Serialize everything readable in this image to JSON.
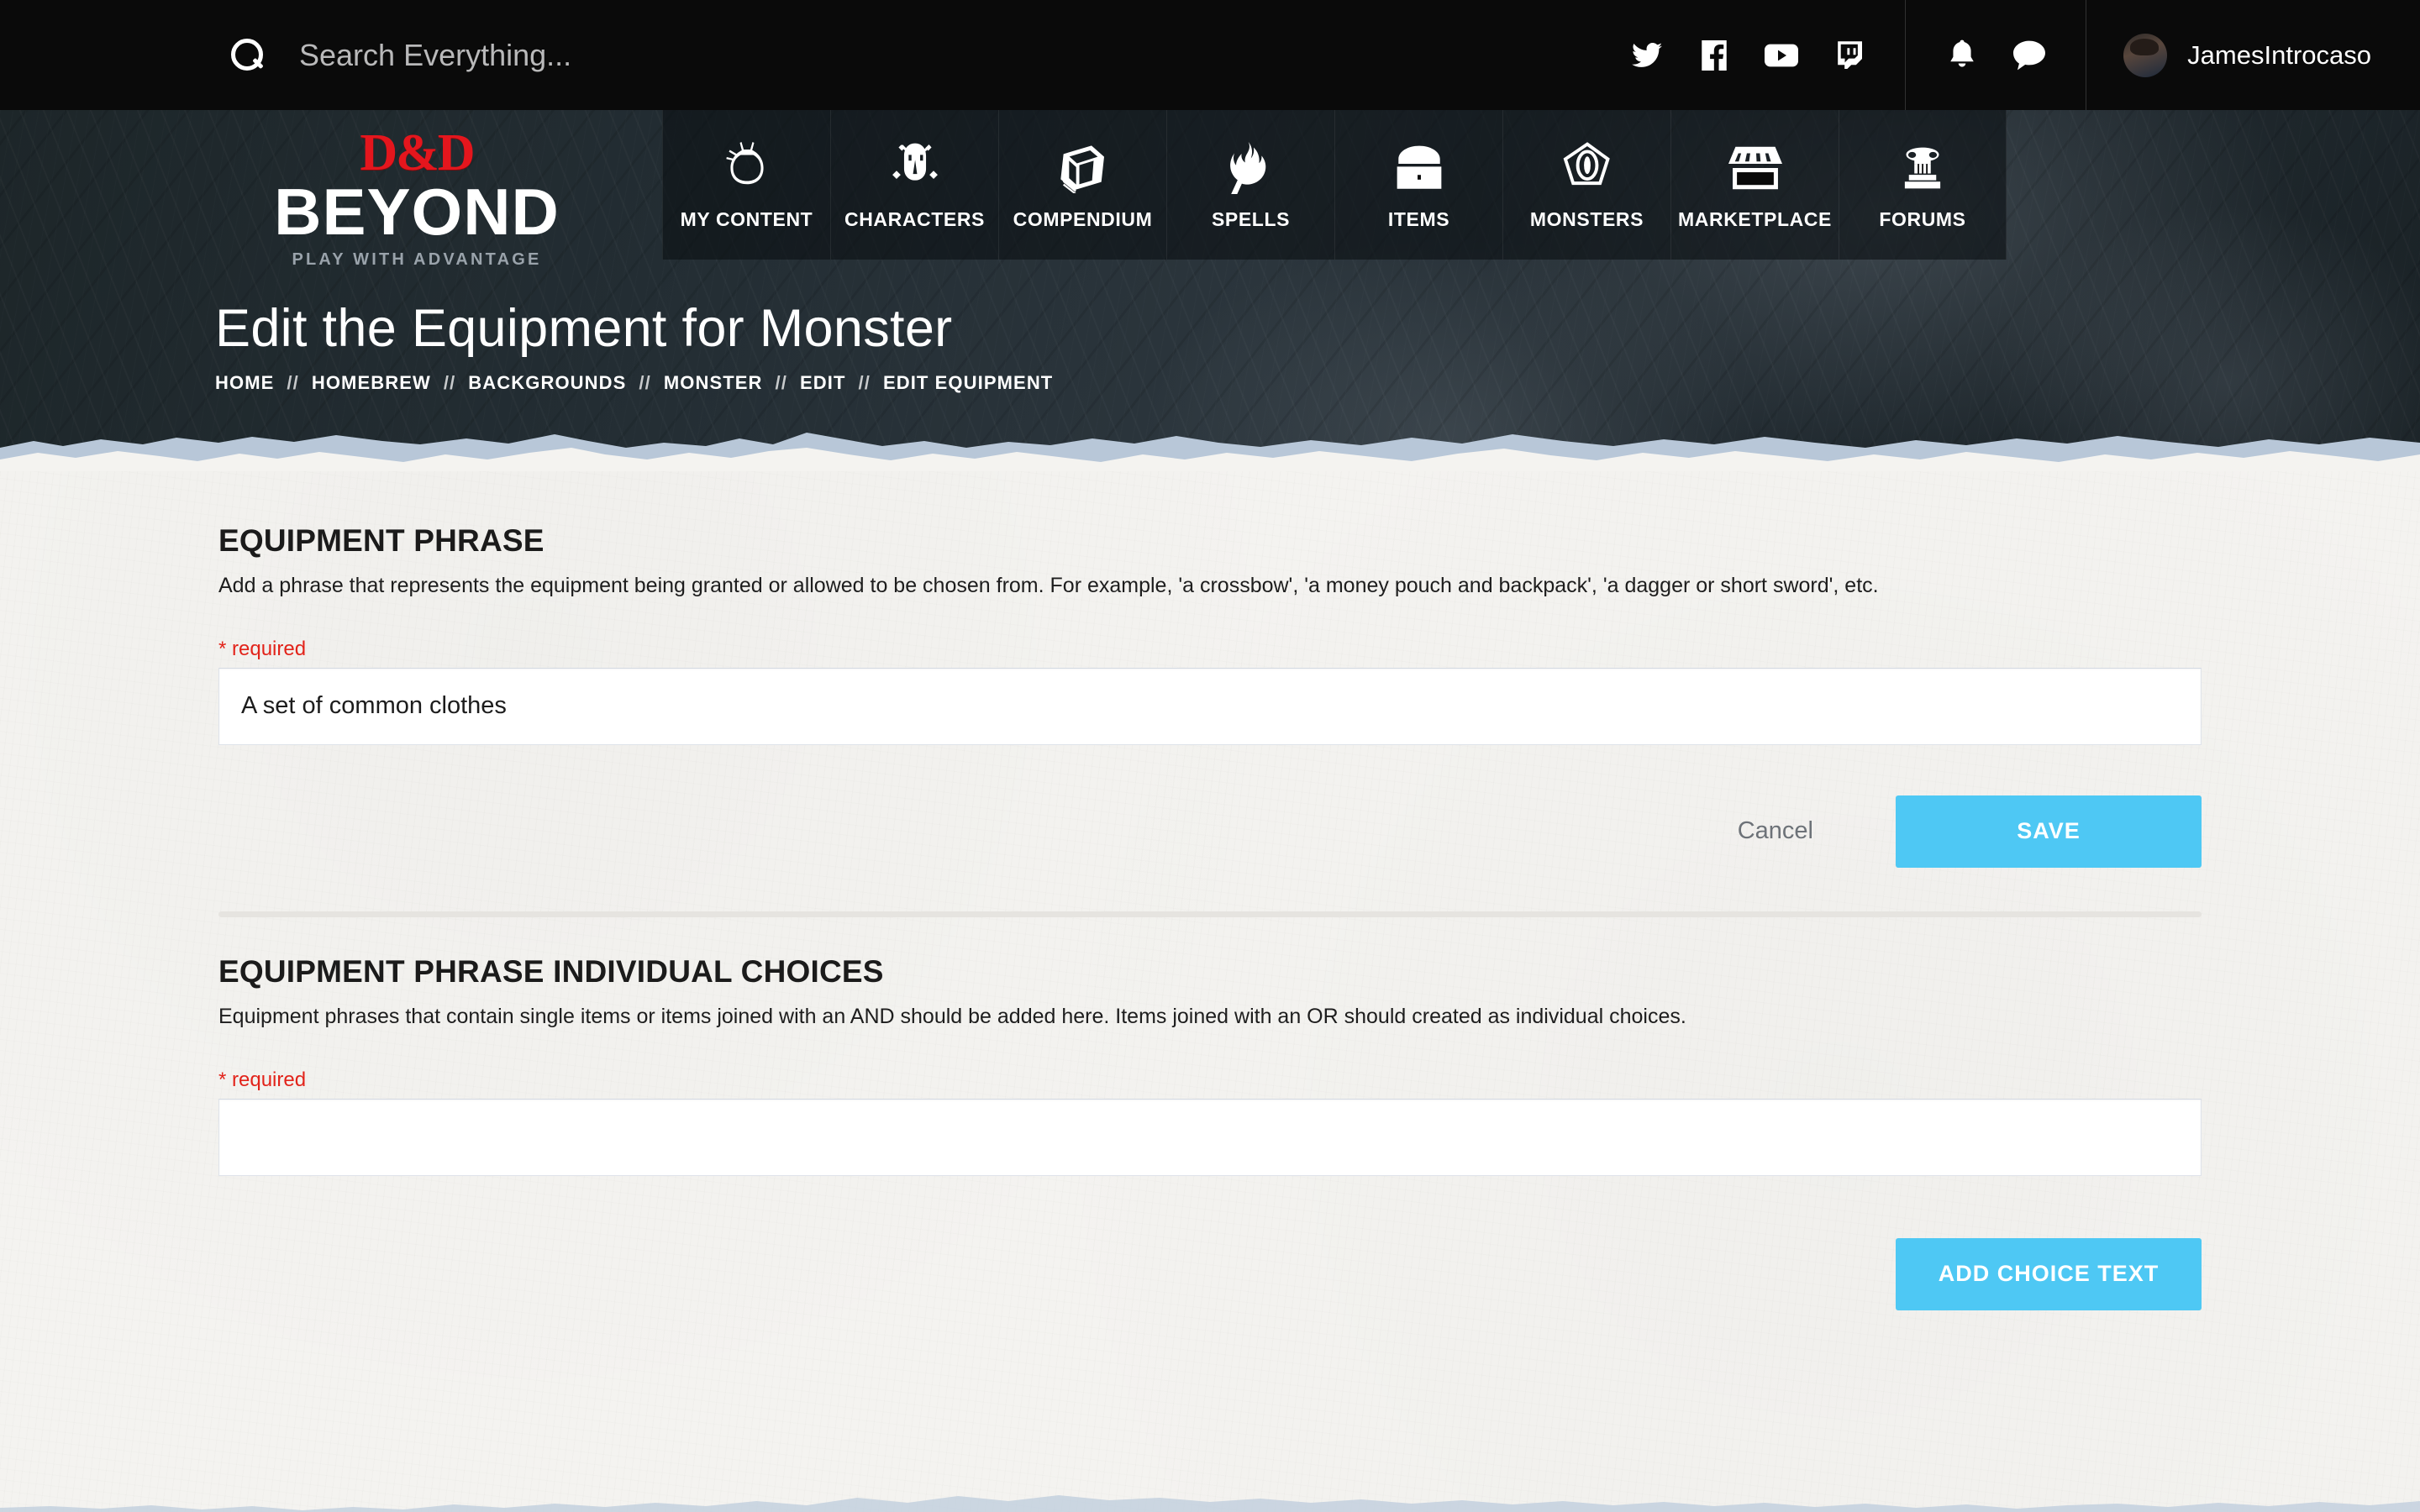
{
  "topbar": {
    "search": {
      "placeholder": "Search Everything...",
      "value": ""
    },
    "social": [
      {
        "name": "twitter-icon",
        "label": "Twitter"
      },
      {
        "name": "facebook-icon",
        "label": "Facebook"
      },
      {
        "name": "youtube-icon",
        "label": "YouTube"
      },
      {
        "name": "twitch-icon",
        "label": "Twitch"
      }
    ],
    "actions": [
      {
        "name": "notifications-bell-icon",
        "label": "Notifications"
      },
      {
        "name": "messages-chat-icon",
        "label": "Messages"
      }
    ],
    "user": {
      "name": "JamesIntrocaso"
    }
  },
  "brand": {
    "dd": "D&D",
    "beyond": "BEYOND",
    "tagline": "PLAY WITH ADVANTAGE"
  },
  "nav": {
    "items": [
      {
        "label": "MY CONTENT",
        "icon": "money-pouch-icon"
      },
      {
        "label": "CHARACTERS",
        "icon": "helmet-icon"
      },
      {
        "label": "COMPENDIUM",
        "icon": "book-icon"
      },
      {
        "label": "SPELLS",
        "icon": "flame-hand-icon"
      },
      {
        "label": "ITEMS",
        "icon": "treasure-chest-icon"
      },
      {
        "label": "MONSTERS",
        "icon": "monster-eye-icon"
      },
      {
        "label": "MARKETPLACE",
        "icon": "storefront-icon"
      },
      {
        "label": "FORUMS",
        "icon": "pillar-icon"
      }
    ]
  },
  "header": {
    "title": "Edit the Equipment for Monster",
    "breadcrumb": [
      "HOME",
      "HOMEBREW",
      "BACKGROUNDS",
      "MONSTER",
      "EDIT",
      "EDIT EQUIPMENT"
    ],
    "breadcrumb_separator": "//"
  },
  "main": {
    "equipment_phrase": {
      "title": "EQUIPMENT PHRASE",
      "description": "Add a phrase that represents the equipment being granted or allowed to be chosen from. For example, 'a crossbow', 'a money pouch and backpack', 'a dagger or short sword', etc.",
      "required_label": "* required",
      "input_value": "A set of common clothes",
      "input_placeholder": "",
      "cancel_label": "Cancel",
      "save_label": "SAVE"
    },
    "individual_choices": {
      "title": "EQUIPMENT PHRASE INDIVIDUAL CHOICES",
      "description": "Equipment phrases that contain single items or items joined with an AND should be added here. Items joined with an OR should created as individual choices.",
      "required_label": "* required",
      "input_value": "",
      "input_placeholder": "",
      "add_label": "ADD CHOICE TEXT"
    }
  },
  "colors": {
    "accent_blue": "#4ec8f4",
    "brand_red": "#e4161d",
    "required_red": "#e2231a",
    "topbar_black": "#0a0a0a",
    "hero_dark": "#222c32",
    "paper": "#f4f3f0"
  }
}
